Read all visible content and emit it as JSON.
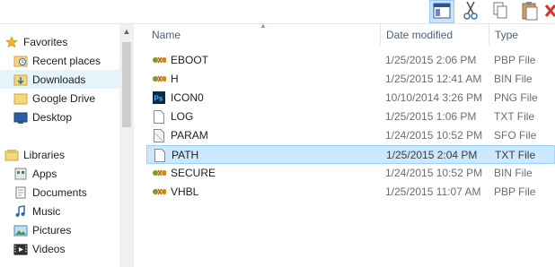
{
  "toolbar": {
    "buttons": [
      {
        "icon": "layout-pane-icon"
      },
      {
        "icon": "scissors-icon"
      },
      {
        "icon": "copy-icon"
      },
      {
        "icon": "paste-icon"
      },
      {
        "icon": "delete-icon"
      }
    ]
  },
  "nav": {
    "items": [
      {
        "label": "Favorites",
        "icon": "star-icon"
      },
      {
        "label": "Recent places",
        "icon": "recent-places-icon"
      },
      {
        "label": "Downloads",
        "icon": "downloads-icon"
      },
      {
        "label": "Google Drive",
        "icon": "google-drive-icon"
      },
      {
        "label": "Desktop",
        "icon": "desktop-icon"
      },
      {
        "label": "Libraries",
        "icon": "libraries-icon"
      },
      {
        "label": "Apps",
        "icon": "apps-icon"
      },
      {
        "label": "Documents",
        "icon": "documents-icon"
      },
      {
        "label": "Music",
        "icon": "music-icon"
      },
      {
        "label": "Pictures",
        "icon": "pictures-icon"
      },
      {
        "label": "Videos",
        "icon": "videos-icon"
      }
    ]
  },
  "columns": {
    "name": "Name",
    "date": "Date modified",
    "type": "Type"
  },
  "files": [
    {
      "name": "EBOOT",
      "date": "1/25/2015 2:06 PM",
      "type": "PBP File",
      "icon": "media-file-icon"
    },
    {
      "name": "H",
      "date": "1/25/2015 12:41 AM",
      "type": "BIN File",
      "icon": "media-file-icon"
    },
    {
      "name": "ICON0",
      "date": "10/10/2014 3:26 PM",
      "type": "PNG File",
      "icon": "photoshop-icon"
    },
    {
      "name": "LOG",
      "date": "1/25/2015 1:06 PM",
      "type": "TXT File",
      "icon": "text-file-icon"
    },
    {
      "name": "PARAM",
      "date": "1/24/2015 10:52 PM",
      "type": "SFO File",
      "icon": "generic-file-icon"
    },
    {
      "name": "PATH",
      "date": "1/25/2015 2:04 PM",
      "type": "TXT File",
      "icon": "text-file-icon"
    },
    {
      "name": "SECURE",
      "date": "1/24/2015 10:52 PM",
      "type": "BIN File",
      "icon": "media-file-icon"
    },
    {
      "name": "VHBL",
      "date": "1/25/2015 11:07 AM",
      "type": "PBP File",
      "icon": "media-file-icon"
    }
  ],
  "colors": {
    "selection": "#cce8ff",
    "selection_border": "#99d1ff",
    "header_text": "#4c607a"
  }
}
